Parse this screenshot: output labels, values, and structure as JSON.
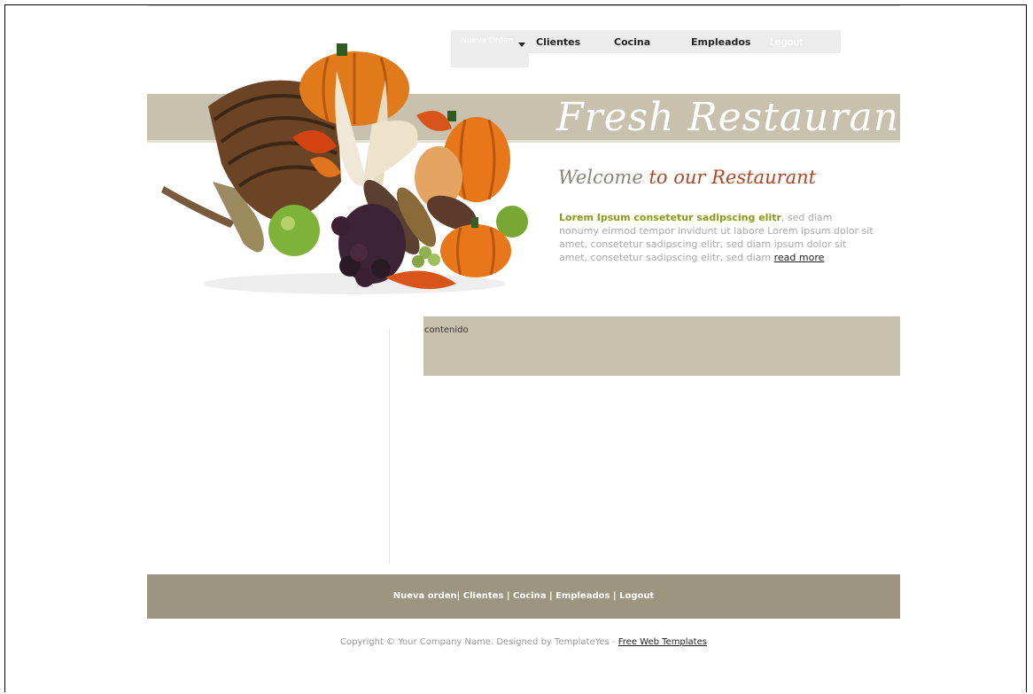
{
  "nav": {
    "nueva_orden": "Nueva Orden",
    "clientes": "Clientes",
    "cocina": "Cocina",
    "empleados": "Empleados",
    "logout": "Logout"
  },
  "header": {
    "title": "Fresh Restaurant"
  },
  "welcome": {
    "part1": "Welcome",
    "part2": "to our Restaurant",
    "lead": "Lorem Ipsum consetetur sadipscing elitr",
    "body": ", sed diam nonumy eirmod tempor invidunt ut labore Lorem ipsum dolor sit amet, consetetur sadipscing elitr, sed diam ipsum dolor sit amet, consetetur sadipscing elitr, sed diam ",
    "read_more": "read more"
  },
  "content": {
    "label": "contenido"
  },
  "footer": {
    "links": [
      "Nueva orden",
      "Clientes",
      "Cocina",
      "Empleados",
      "Logout"
    ],
    "copyright": "Copyright © Your Company Name. Designed by TemplateYes - ",
    "copyright_link": "Free Web Templates"
  },
  "colors": {
    "band": "#c8c1ae",
    "footer": "#9e9580",
    "welcome_accent": "#b14727",
    "lead_green": "#8a9a18"
  }
}
